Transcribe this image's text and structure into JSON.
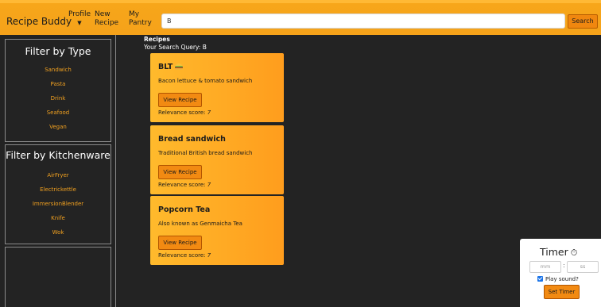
{
  "nav": {
    "brand": "Recipe Buddy",
    "profile": "Profile",
    "new_recipe_line1": "New",
    "new_recipe_line2": "Recipe",
    "pantry_line1": "My",
    "pantry_line2": "Pantry",
    "search_value": "B",
    "search_button": "Search"
  },
  "sidebar": {
    "type_title": "Filter by Type",
    "types": [
      "Sandwich",
      "Pasta",
      "Drink",
      "Seafood",
      "Vegan"
    ],
    "kitchen_title": "Filter by Kitchenware",
    "kitchenware": [
      "AirFryer",
      "Electrickettle",
      "ImmersionBlender",
      "Knife",
      "Wok"
    ]
  },
  "results": {
    "heading": "Recipes",
    "query_line": "Your Search Query: B"
  },
  "recipes": [
    {
      "title": "BLT",
      "icon": "burger-icon",
      "description": "Bacon lettuce & tomato sandwich",
      "button": "View Recipe",
      "score_label": "Relevance score:",
      "score": "7"
    },
    {
      "title": "Bread sandwich",
      "description": "Traditional British bread sandwich",
      "button": "View Recipe",
      "score_label": "Relevance score:",
      "score": "7"
    },
    {
      "title": "Popcorn Tea",
      "description": "Also known as Genmaicha Tea",
      "button": "View Recipe",
      "score_label": "Relevance score:",
      "score": "7"
    }
  ],
  "timer": {
    "title": "Timer",
    "icon": "stopwatch-icon",
    "mm_placeholder": "mm",
    "ss_placeholder": "ss",
    "colon": ":",
    "sound_label": "Play sound?",
    "sound_checked": true,
    "button": "Set Timer"
  },
  "colors": {
    "accent": "#f7a61a",
    "button": "#f28a12",
    "link": "#f0a020",
    "background": "#232323"
  }
}
